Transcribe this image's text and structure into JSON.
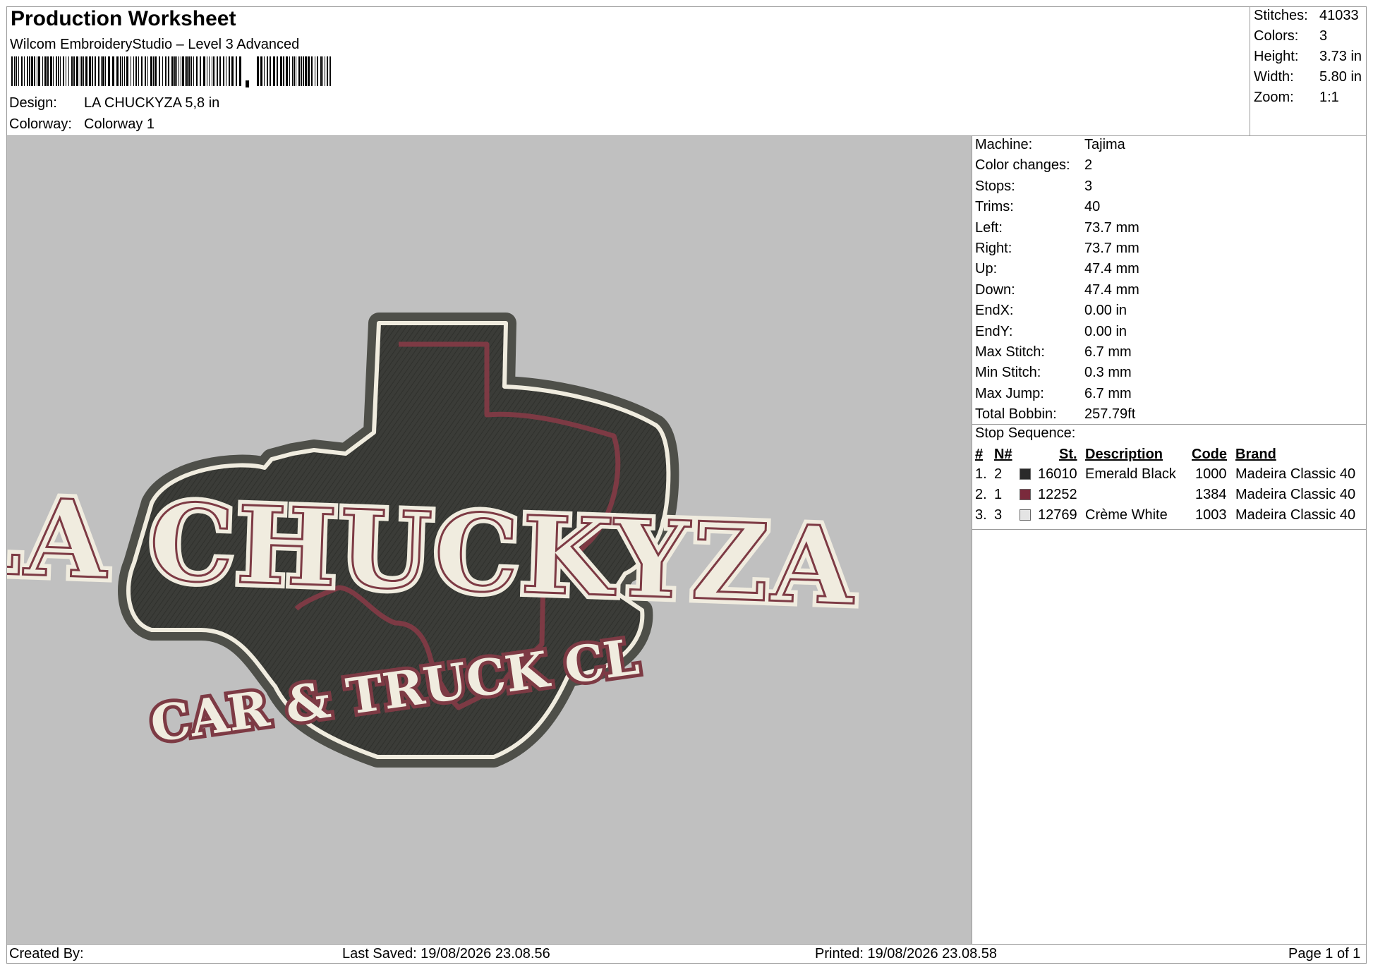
{
  "header": {
    "title": "Production Worksheet",
    "software": "Wilcom EmbroideryStudio – Level 3 Advanced",
    "design_label": "Design:",
    "design_value": "LA CHUCKYZA 5,8 in",
    "colorway_label": "Colorway:",
    "colorway_value": "Colorway 1"
  },
  "stats": {
    "stitches_label": "Stitches:",
    "stitches": "41033",
    "colors_label": "Colors:",
    "colors": "3",
    "height_label": "Height:",
    "height": "3.73 in",
    "width_label": "Width:",
    "width": "5.80 in",
    "zoom_label": "Zoom:",
    "zoom": "1:1"
  },
  "machine_info": [
    {
      "label": "Machine:",
      "value": "Tajima"
    },
    {
      "label": "Color changes:",
      "value": "2"
    },
    {
      "label": "Stops:",
      "value": "3"
    },
    {
      "label": "Trims:",
      "value": "40"
    },
    {
      "label": "Left:",
      "value": "73.7 mm"
    },
    {
      "label": "Right:",
      "value": "73.7 mm"
    },
    {
      "label": "Up:",
      "value": "47.4 mm"
    },
    {
      "label": "Down:",
      "value": "47.4 mm"
    },
    {
      "label": "EndX:",
      "value": "0.00 in"
    },
    {
      "label": "EndY:",
      "value": "0.00 in"
    },
    {
      "label": "Max Stitch:",
      "value": "6.7 mm"
    },
    {
      "label": "Min Stitch:",
      "value": "0.3 mm"
    },
    {
      "label": "Max Jump:",
      "value": "6.7 mm"
    },
    {
      "label": "Total Bobbin:",
      "value": "257.79ft"
    }
  ],
  "stop_sequence": {
    "title": "Stop Sequence:",
    "headers": {
      "num": "#",
      "n": "N#",
      "st": "St.",
      "desc": "Description",
      "code": "Code",
      "brand": "Brand"
    },
    "rows": [
      {
        "num": "1.",
        "n": "2",
        "color": "#2a2a2a",
        "st": "16010",
        "desc": "Emerald Black",
        "code": "1000",
        "brand": "Madeira Classic 40"
      },
      {
        "num": "2.",
        "n": "1",
        "color": "#7a2a3c",
        "st": "12252",
        "desc": "",
        "code": "1384",
        "brand": "Madeira Classic 40"
      },
      {
        "num": "3.",
        "n": "3",
        "color": "#e4e4e4",
        "st": "12769",
        "desc": "Crème White",
        "code": "1003",
        "brand": "Madeira Classic 40"
      }
    ]
  },
  "design_preview": {
    "main_text": "LA CHUCKYZA",
    "sub_text": "CAR & TRUCK CL",
    "colors": {
      "outline": "#4e4f49",
      "fill": "#3b3c38",
      "accent": "#7d3a44",
      "cream": "#f0ecdf",
      "background": "#c0c0c0"
    }
  },
  "footer": {
    "created": "Created By:",
    "saved": "Last Saved: 19/08/2026 23.08.56",
    "printed": "Printed: 19/08/2026 23.08.58",
    "page": "Page 1 of 1"
  }
}
